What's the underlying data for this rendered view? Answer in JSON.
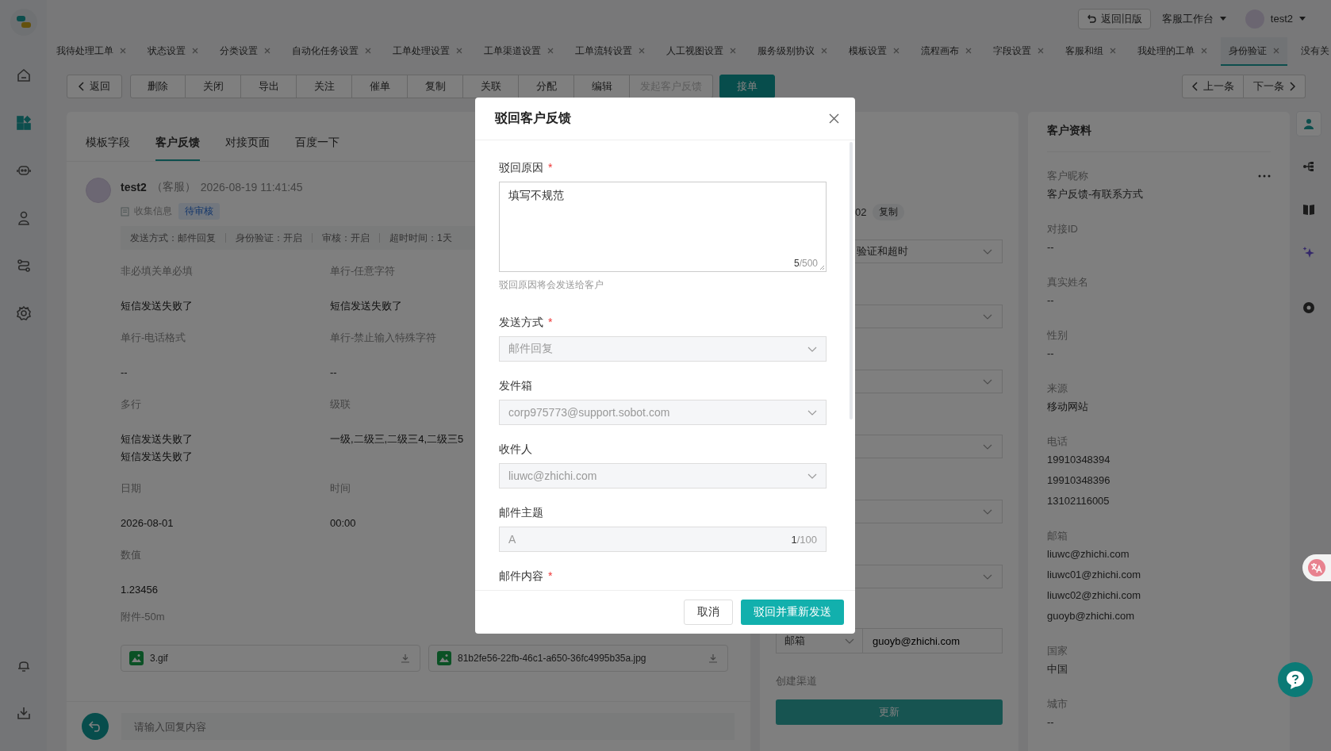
{
  "sidebar": [
    {
      "kind": "home",
      "selected": false
    },
    {
      "kind": "grid",
      "selected": true
    },
    {
      "kind": "robot",
      "selected": false
    },
    {
      "kind": "person",
      "selected": false
    },
    {
      "kind": "route",
      "selected": false
    },
    {
      "kind": "gear",
      "selected": false
    }
  ],
  "sidebar_bottom": [
    {
      "kind": "bell"
    },
    {
      "kind": "download"
    }
  ],
  "topbar": {
    "back_old": "返回旧版",
    "workspace": "客服工作台",
    "user": "test2"
  },
  "nav_tabs": [
    {
      "label": "我待处理工单",
      "selected": false,
      "closable": true
    },
    {
      "label": "状态设置",
      "selected": false,
      "closable": true
    },
    {
      "label": "分类设置",
      "selected": false,
      "closable": true
    },
    {
      "label": "自动化任务设置",
      "selected": false,
      "closable": true
    },
    {
      "label": "工单处理设置",
      "selected": false,
      "closable": true
    },
    {
      "label": "工单渠道设置",
      "selected": false,
      "closable": true
    },
    {
      "label": "工单流转设置",
      "selected": false,
      "closable": true
    },
    {
      "label": "人工视图设置",
      "selected": false,
      "closable": true
    },
    {
      "label": "服务级别协议",
      "selected": false,
      "closable": true
    },
    {
      "label": "模板设置",
      "selected": false,
      "closable": true
    },
    {
      "label": "流程画布",
      "selected": false,
      "closable": true
    },
    {
      "label": "字段设置",
      "selected": false,
      "closable": true
    },
    {
      "label": "客服和组",
      "selected": false,
      "closable": true
    },
    {
      "label": "我处理的工单",
      "selected": false,
      "closable": true
    },
    {
      "label": "身份验证",
      "selected": true,
      "closable": true
    },
    {
      "label": "没有关",
      "selected": false,
      "closable": false
    }
  ],
  "toolbar": {
    "back": "返回",
    "actions": [
      {
        "label": "删除",
        "disabled": false
      },
      {
        "label": "关闭",
        "disabled": false
      },
      {
        "label": "导出",
        "disabled": false
      },
      {
        "label": "关注",
        "disabled": false
      },
      {
        "label": "催单",
        "disabled": false
      },
      {
        "label": "复制",
        "disabled": false
      },
      {
        "label": "关联",
        "disabled": false
      },
      {
        "label": "分配",
        "disabled": false
      },
      {
        "label": "编辑",
        "disabled": false
      },
      {
        "label": "发起客户反馈",
        "disabled": true
      }
    ],
    "primary": "接单",
    "prev": "上一条",
    "next": "下一条"
  },
  "detail": {
    "tabs": [
      {
        "label": "模板字段",
        "selected": false
      },
      {
        "label": "客户反馈",
        "selected": true
      },
      {
        "label": "对接页面",
        "selected": false
      },
      {
        "label": "百度一下",
        "selected": false
      }
    ],
    "message": {
      "author": "test2",
      "role": "（客服）",
      "time": "2026-08-19 11:41:45",
      "form_name": "收集信息",
      "status": "待审核",
      "meta": [
        "发送方式：邮件回复",
        "身份验证：开启",
        "审核：开启",
        "超时时间：1天"
      ]
    },
    "fields": [
      {
        "label": "非必填关单必填",
        "values": [
          "短信发送失败了"
        ]
      },
      {
        "label": "单行-任意字符",
        "values": [
          "短信发送失败了"
        ]
      },
      {
        "label": "单行-电话格式",
        "values": [
          "--"
        ]
      },
      {
        "label": "单行-禁止输入特殊字符",
        "values": [
          "--"
        ]
      },
      {
        "label": "多行",
        "values": [
          "短信发送失败了",
          "短信发送失败了"
        ]
      },
      {
        "label": "级联",
        "values": [
          "一级,二级三,二级三4,二级三5"
        ]
      },
      {
        "label": "日期",
        "values": [
          "2026-08-01"
        ]
      },
      {
        "label": "时间",
        "values": [
          "00:00"
        ]
      },
      {
        "label": "数值",
        "values": [
          "1.23456"
        ]
      }
    ],
    "attachments_label": "附件-50m",
    "attachments": [
      "3.gif",
      "81b2fe56-22fb-46c1-a650-36fc4995b35a.jpg"
    ],
    "reply_placeholder": "请输入回复内容"
  },
  "middle": {
    "id_tail": "02",
    "copy": "复制",
    "select_value": "验证和超时",
    "contact_type": "邮箱",
    "contact_value": "guoyb@zhichi.com",
    "channel_label": "创建渠道",
    "update": "更新"
  },
  "customer": {
    "title": "客户资料",
    "fields": [
      {
        "label": "客户昵称",
        "values": [
          "客户反馈-有联系方式"
        ]
      },
      {
        "label": "对接ID",
        "values": [
          "--"
        ]
      },
      {
        "label": "真实姓名",
        "values": [
          "--"
        ]
      },
      {
        "label": "性别",
        "values": [
          "--"
        ]
      },
      {
        "label": "来源",
        "values": [
          "移动网站"
        ]
      },
      {
        "label": "电话",
        "values": [
          "19910348394",
          "19910348396",
          "13102116005"
        ]
      },
      {
        "label": "邮箱",
        "values": [
          "liuwc@zhichi.com",
          "liuwc01@zhichi.com",
          "liuwc02@zhichi.com",
          "guoyb@zhichi.com"
        ]
      },
      {
        "label": "国家",
        "values": [
          "中国"
        ]
      },
      {
        "label": "城市",
        "values": [
          "--"
        ]
      }
    ]
  },
  "rail": [
    {
      "kind": "person",
      "selected": true
    },
    {
      "kind": "tree",
      "selected": false
    },
    {
      "kind": "book",
      "selected": false
    },
    {
      "kind": "sparkle",
      "selected": false
    },
    {
      "kind": "gear",
      "selected": false
    }
  ],
  "dialog": {
    "title": "驳回客户反馈",
    "reason": {
      "label": "驳回原因",
      "required": "*",
      "value": "填写不规范",
      "used": "5",
      "limit": "/500",
      "hint": "驳回原因将会发送给客户"
    },
    "selects": [
      {
        "label": "发送方式",
        "required": "*",
        "value": "邮件回复"
      },
      {
        "label": "发件箱",
        "value": "corp975773@support.sobot.com"
      },
      {
        "label": "收件人",
        "value": "liuwc@zhichi.com"
      }
    ],
    "subject": {
      "label": "邮件主题",
      "value": "A",
      "used": "1",
      "limit": "/100"
    },
    "content": {
      "label": "邮件内容",
      "required": "*"
    },
    "cancel": "取消",
    "confirm": "驳回并重新发送"
  }
}
